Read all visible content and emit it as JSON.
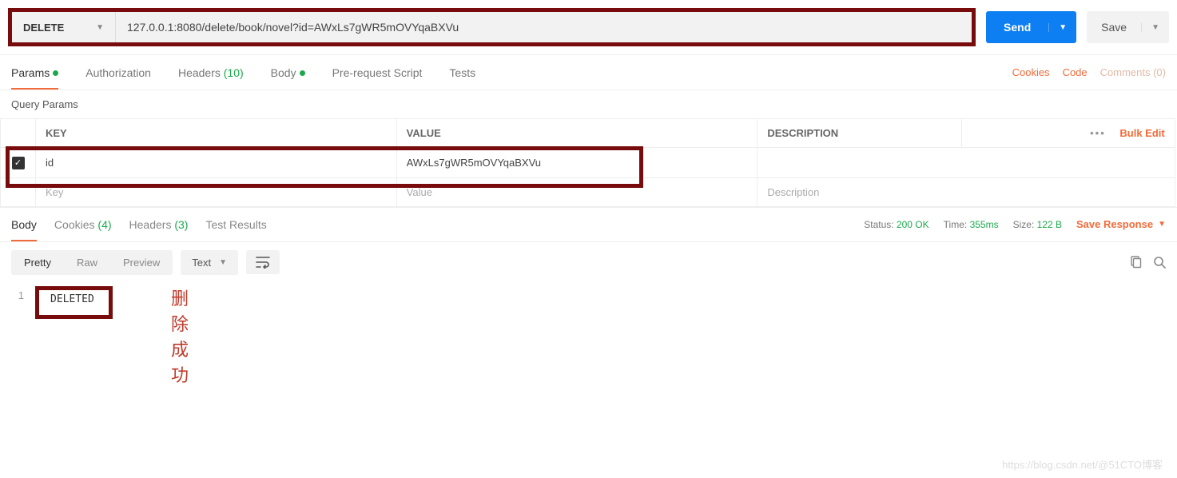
{
  "request": {
    "method": "DELETE",
    "url": "127.0.0.1:8080/delete/book/novel?id=AWxLs7gWR5mOVYqaBXVu",
    "send_label": "Send",
    "save_label": "Save"
  },
  "tabs": {
    "params": "Params",
    "authorization": "Authorization",
    "headers": "Headers",
    "headers_count": "(10)",
    "body": "Body",
    "prerequest": "Pre-request Script",
    "tests": "Tests"
  },
  "links": {
    "cookies": "Cookies",
    "code": "Code",
    "comments": "Comments (0)"
  },
  "params": {
    "section_title": "Query Params",
    "headers": {
      "key": "KEY",
      "value": "VALUE",
      "description": "DESCRIPTION"
    },
    "bulk_edit": "Bulk Edit",
    "rows": [
      {
        "enabled": true,
        "key": "id",
        "value": "AWxLs7gWR5mOVYqaBXVu",
        "description": ""
      }
    ],
    "placeholders": {
      "key": "Key",
      "value": "Value",
      "description": "Description"
    }
  },
  "response": {
    "tabs": {
      "body": "Body",
      "cookies": "Cookies",
      "cookies_count": "(4)",
      "headers": "Headers",
      "headers_count": "(3)",
      "test_results": "Test Results"
    },
    "status_label": "Status:",
    "status_value": "200 OK",
    "time_label": "Time:",
    "time_value": "355ms",
    "size_label": "Size:",
    "size_value": "122 B",
    "save_response": "Save Response"
  },
  "view": {
    "pretty": "Pretty",
    "raw": "Raw",
    "preview": "Preview",
    "format": "Text"
  },
  "body_content": {
    "line_no": "1",
    "text": "DELETED",
    "annotation": "删除成功"
  },
  "watermark": "https://blog.csdn.net/@51CTO博客"
}
